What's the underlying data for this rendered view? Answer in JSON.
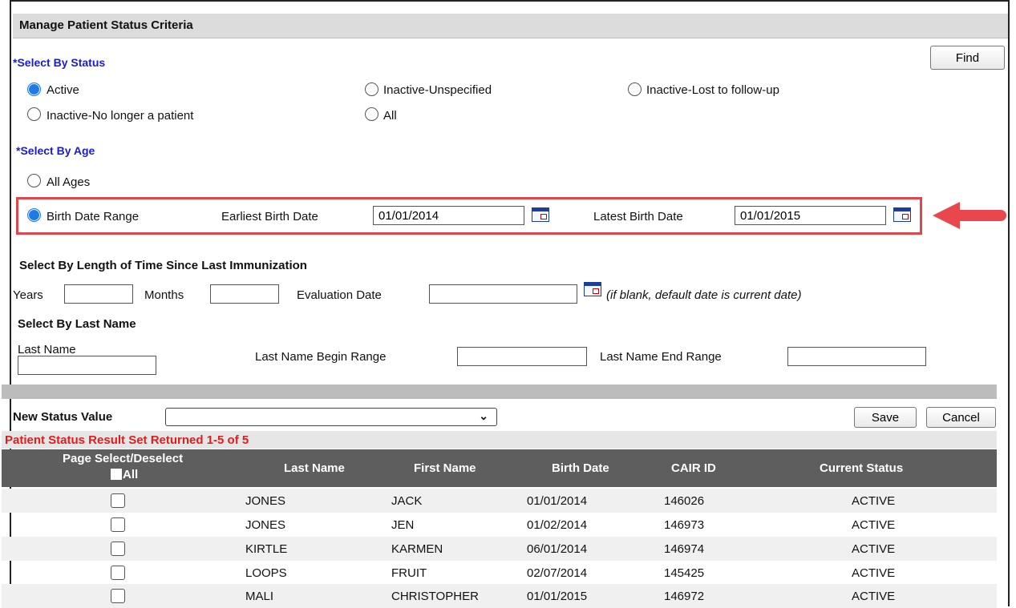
{
  "page": {
    "title": "Manage Patient Status Criteria",
    "find_label": "Find"
  },
  "status": {
    "heading": "*Select By Status",
    "options": [
      "Active",
      "Inactive-Unspecified",
      "Inactive-Lost to follow-up",
      "Inactive-No longer a patient",
      "All"
    ],
    "selected": "Active"
  },
  "age": {
    "heading": "*Select By Age",
    "all_ages_label": "All Ages",
    "birth_range_label": "Birth Date Range",
    "earliest_label": "Earliest Birth Date",
    "earliest_value": "01/01/2014",
    "latest_label": "Latest Birth Date",
    "latest_value": "01/01/2015",
    "selected": "Birth Date Range"
  },
  "length": {
    "heading": "Select By Length of Time Since Last Immunization",
    "years_label": "Years",
    "years_value": "",
    "months_label": "Months",
    "months_value": "",
    "eval_label": "Evaluation Date",
    "eval_value": "",
    "eval_hint": "(if blank, default date is current date)"
  },
  "lastname": {
    "heading": "Select By Last Name",
    "last_name_label": "Last Name",
    "last_name_value": "",
    "begin_label": "Last Name Begin Range",
    "begin_value": "",
    "end_label": "Last Name End Range",
    "end_value": ""
  },
  "new_status": {
    "label": "New Status Value",
    "value": ""
  },
  "actions": {
    "save": "Save",
    "cancel": "Cancel"
  },
  "results": {
    "summary": "Patient Status Result Set Returned 1-5 of 5",
    "columns": {
      "select": "Page Select/Deselect",
      "select_all": "All",
      "last_name": "Last Name",
      "first_name": "First Name",
      "birth_date": "Birth Date",
      "cair_id": "CAIR ID",
      "current_status": "Current Status"
    },
    "rows": [
      {
        "last": "JONES",
        "first": "JACK",
        "dob": "01/01/2014",
        "id": "146026",
        "status": "ACTIVE"
      },
      {
        "last": "JONES",
        "first": "JEN",
        "dob": "01/02/2014",
        "id": "146973",
        "status": "ACTIVE"
      },
      {
        "last": "KIRTLE",
        "first": "KARMEN",
        "dob": "06/01/2014",
        "id": "146974",
        "status": "ACTIVE"
      },
      {
        "last": "LOOPS",
        "first": "FRUIT",
        "dob": "02/07/2014",
        "id": "145425",
        "status": "ACTIVE"
      },
      {
        "last": "MALI",
        "first": "CHRISTOPHER",
        "dob": "01/01/2015",
        "id": "146972",
        "status": "ACTIVE"
      }
    ]
  },
  "colors": {
    "header_bg": "#dcdcdc",
    "table_header_bg": "#5e5e5e",
    "accent_red": "#e31b1b",
    "section_blue": "#1b1bd6",
    "radio_blue": "#1e7be6"
  }
}
